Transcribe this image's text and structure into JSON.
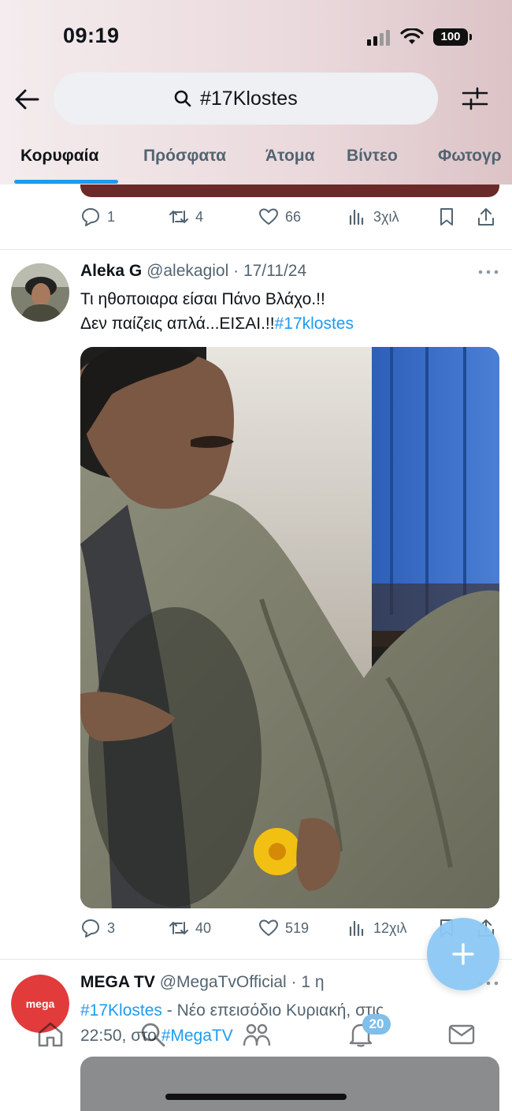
{
  "status_bar": {
    "time": "09:19",
    "battery": "100"
  },
  "search": {
    "value": "#17Klostes"
  },
  "tabs": [
    {
      "label": "Κορυφαία",
      "active": true
    },
    {
      "label": "Πρόσφατα",
      "active": false
    },
    {
      "label": "Άτομα",
      "active": false
    },
    {
      "label": "Βίντεο",
      "active": false
    },
    {
      "label": "Φωτογρ",
      "active": false
    }
  ],
  "previous_tweet": {
    "replies": "1",
    "reposts": "4",
    "likes": "66",
    "views": "3χιλ"
  },
  "tweet": {
    "name": "Aleka G",
    "handle": "@alekagiol",
    "date": "· 17/11/24",
    "text_line1": "Τι ηθοποιαρα είσαι Πάνο Βλάχο.!!",
    "text_line2": "Δεν παίζεις απλά...ΕΙΣΑΙ.!!",
    "hashtag": "#17klostes",
    "replies": "3",
    "reposts": "40",
    "likes": "519",
    "views": "12χιλ"
  },
  "tweet2": {
    "name": "MEGA TV",
    "handle": "@MegaTvOfficial",
    "date": "· 1 η",
    "avatar_text": "mega",
    "hashtag1": "#17Klostes",
    "text1": " - Νέο επεισόδιο Κυριακή, στις",
    "text2": "22:50, στο ",
    "hashtag2": "#MegaTV"
  },
  "bottom_nav": {
    "notifications_badge": "20"
  },
  "colors": {
    "accent": "#1d9bf0",
    "text": "#0f1419",
    "muted": "#536471"
  }
}
